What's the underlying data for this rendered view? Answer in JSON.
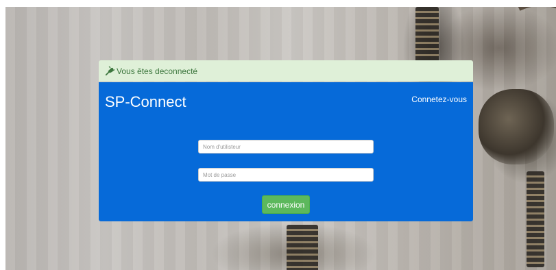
{
  "alert": {
    "icon": "plug-icon",
    "message": "Vous êtes deconnecté",
    "color": "#3c763d",
    "background": "#dff0d8"
  },
  "header": {
    "brand": "SP-Connect",
    "login_link": "Connetez-vous"
  },
  "form": {
    "username": {
      "placeholder": "Nom d'utilisteur",
      "value": ""
    },
    "password": {
      "placeholder": "Mot de passe",
      "value": ""
    },
    "submit_label": "connexion"
  },
  "colors": {
    "panel": "#066ad9",
    "button": "#5cb85c"
  }
}
